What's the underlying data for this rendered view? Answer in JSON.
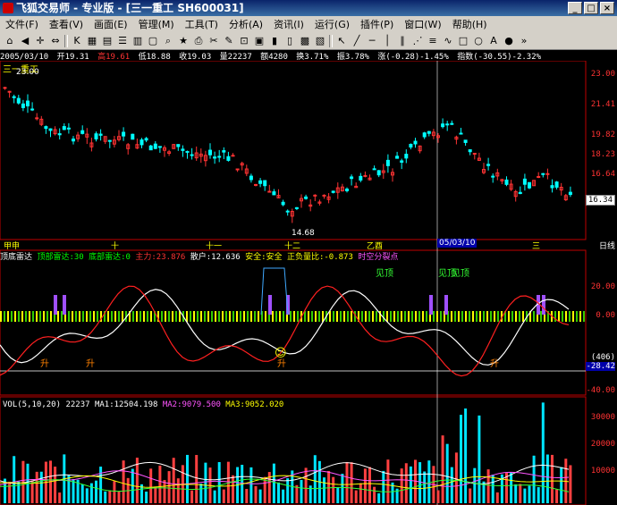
{
  "window": {
    "title": "飞狐交易师 - 专业版 - [三一重工 SH600031]"
  },
  "menu": [
    "文件(F)",
    "查看(V)",
    "画面(E)",
    "管理(M)",
    "工具(T)",
    "分析(A)",
    "资讯(I)",
    "运行(G)",
    "插件(P)",
    "窗口(W)",
    "帮助(H)"
  ],
  "stock": {
    "name": "三一重工",
    "date": "2005/03/10",
    "open": "开19.31",
    "high": "高19.61",
    "low": "低18.88",
    "close": "收19.03",
    "volume": "量22237",
    "amount": "额4280",
    "turnover": "换3.71%",
    "amplitude": "振3.78%",
    "change": "涨(-0.28)-1.45%",
    "index": "指数(-30.55)-2.32%",
    "high_mark": "23.00",
    "low_mark": "14.68",
    "price_axis": [
      "23.00",
      "21.41",
      "19.82",
      "18.23",
      "16.64"
    ],
    "last_price": "16.34"
  },
  "timeline": {
    "labels": [
      "甲申",
      "十",
      "十一",
      "十二",
      "乙酉",
      "三"
    ],
    "cursor_date": "05/03/10",
    "right_label": "日线"
  },
  "indicator": {
    "name": "顶底雷达",
    "items": [
      {
        "text": "顶部雷达:30",
        "color": "#00ff00"
      },
      {
        "text": "底部雷达:0",
        "color": "#00ff00"
      },
      {
        "text": "主力:23.876",
        "color": "#ff3333"
      },
      {
        "text": "散户:12.636",
        "color": "#ffffff"
      },
      {
        "text": "安全:安全",
        "color": "#ffff00"
      },
      {
        "text": "正负量比:-0.873",
        "color": "#ffff00"
      },
      {
        "text": "时空分裂点",
        "color": "#ff55ff"
      }
    ],
    "axis": [
      "20.00",
      "0.00",
      "-20.00",
      "-40.00"
    ],
    "cursor_value": "(406)",
    "cursor_value2": "-28.42",
    "signals": {
      "top": "见顶",
      "bottom": "升",
      "face": "☺"
    }
  },
  "volume": {
    "label": "VOL(5,10,20)",
    "value": "22237",
    "ma1": "MA1:12504.198",
    "ma2": "MA2:9079.500",
    "ma3": "MA3:9052.020",
    "axis": [
      "30000",
      "20000",
      "10000"
    ]
  },
  "colors": {
    "up": "#ff3333",
    "down": "#00ffff",
    "bg": "#000000",
    "frame": "#c00000"
  }
}
